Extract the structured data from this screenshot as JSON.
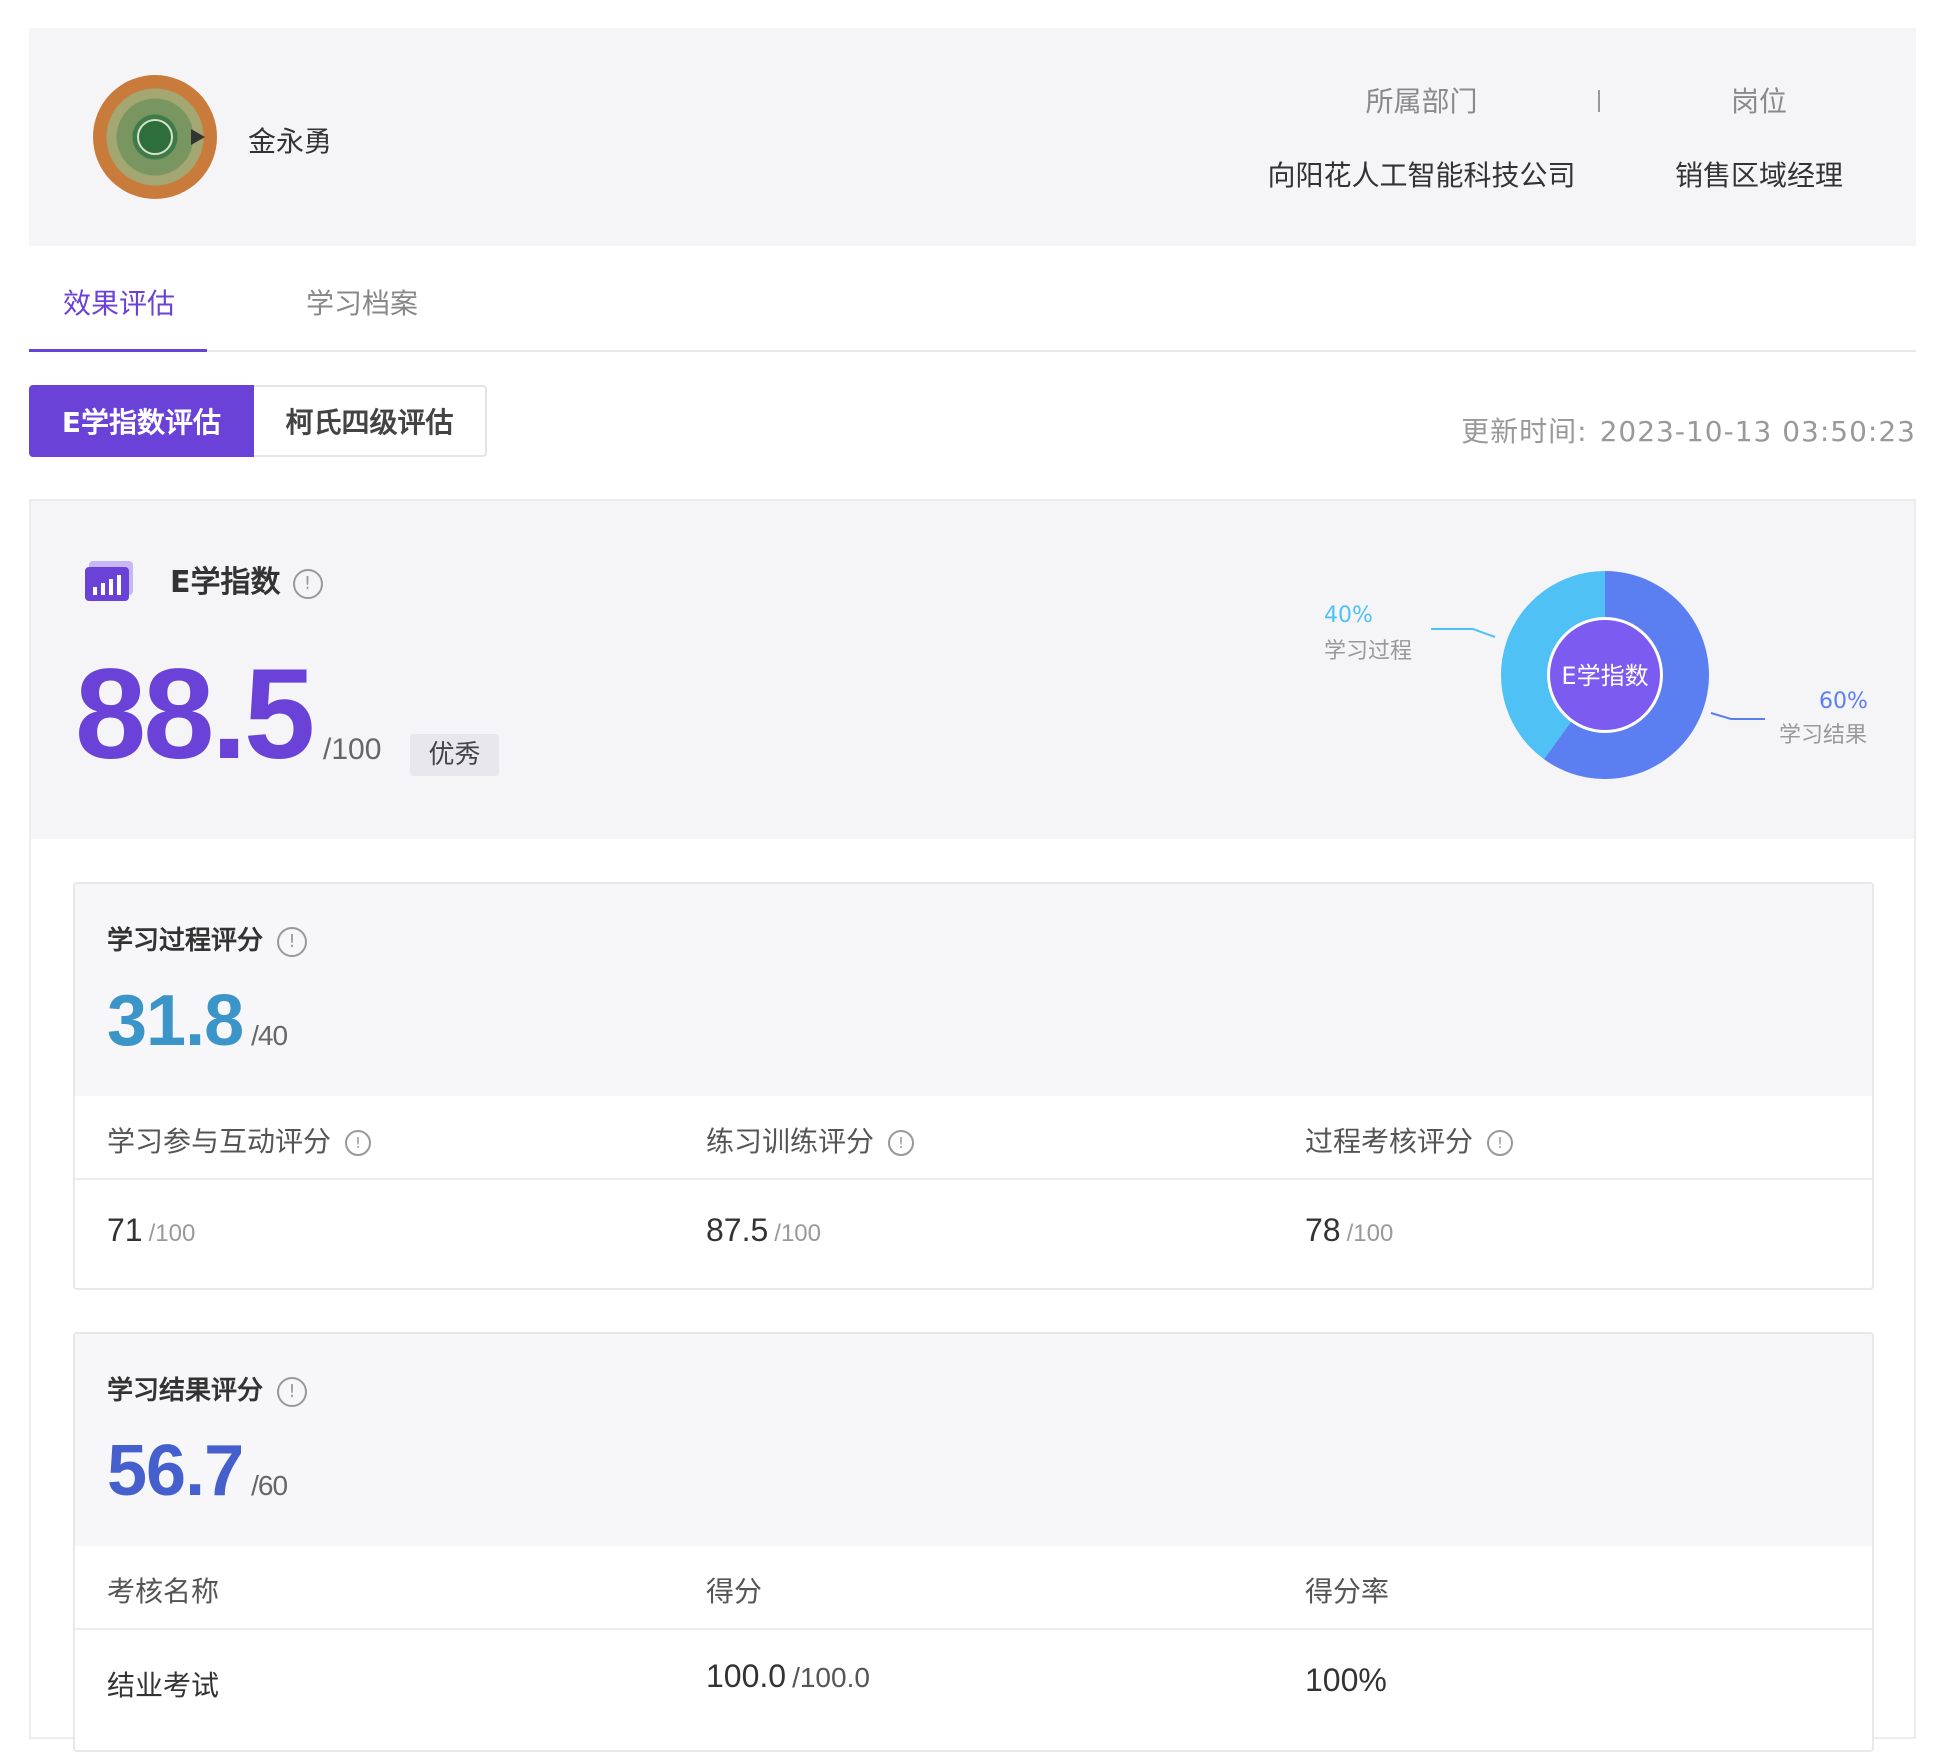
{
  "user": {
    "name": "金永勇",
    "department_label": "所属部门",
    "department_value": "向阳花人工智能科技公司",
    "position_label": "岗位",
    "position_value": "销售区域经理",
    "separator": "|"
  },
  "tabs": [
    {
      "label": "效果评估",
      "active": true
    },
    {
      "label": "学习档案",
      "active": false
    }
  ],
  "segments": [
    {
      "label": "E学指数评估",
      "active": true
    },
    {
      "label": "柯氏四级评估",
      "active": false
    }
  ],
  "update": {
    "label": "更新时间:",
    "value": "2023-10-13 03:50:23"
  },
  "index": {
    "title": "E学指数",
    "score": "88.5",
    "max": "/100",
    "badge": "优秀",
    "accent": "#6a42d8"
  },
  "chart_data": {
    "type": "pie",
    "title": "E学指数",
    "categories": [
      "学习过程",
      "学习结果"
    ],
    "values": [
      40,
      60
    ],
    "value_labels": [
      "40%",
      "60%"
    ],
    "colors": [
      "#4fc1f5",
      "#5b7ff0"
    ],
    "center_color": "#7c5cf0"
  },
  "process": {
    "title": "学习过程评分",
    "score": "31.8",
    "max": "/40",
    "color": "#3c95c8",
    "columns": [
      {
        "label": "学习参与互动评分",
        "value": "71",
        "max": "/100"
      },
      {
        "label": "练习训练评分",
        "value": "87.5",
        "max": "/100"
      },
      {
        "label": "过程考核评分",
        "value": "78",
        "max": "/100"
      }
    ]
  },
  "result": {
    "title": "学习结果评分",
    "score": "56.7",
    "max": "/60",
    "color": "#4560cc",
    "headers": [
      "考核名称",
      "得分",
      "得分率"
    ],
    "rows": [
      {
        "name": "结业考试",
        "score": "100.0",
        "max": "/100.0",
        "rate": "100%"
      }
    ]
  },
  "icons": {
    "info": "!"
  }
}
